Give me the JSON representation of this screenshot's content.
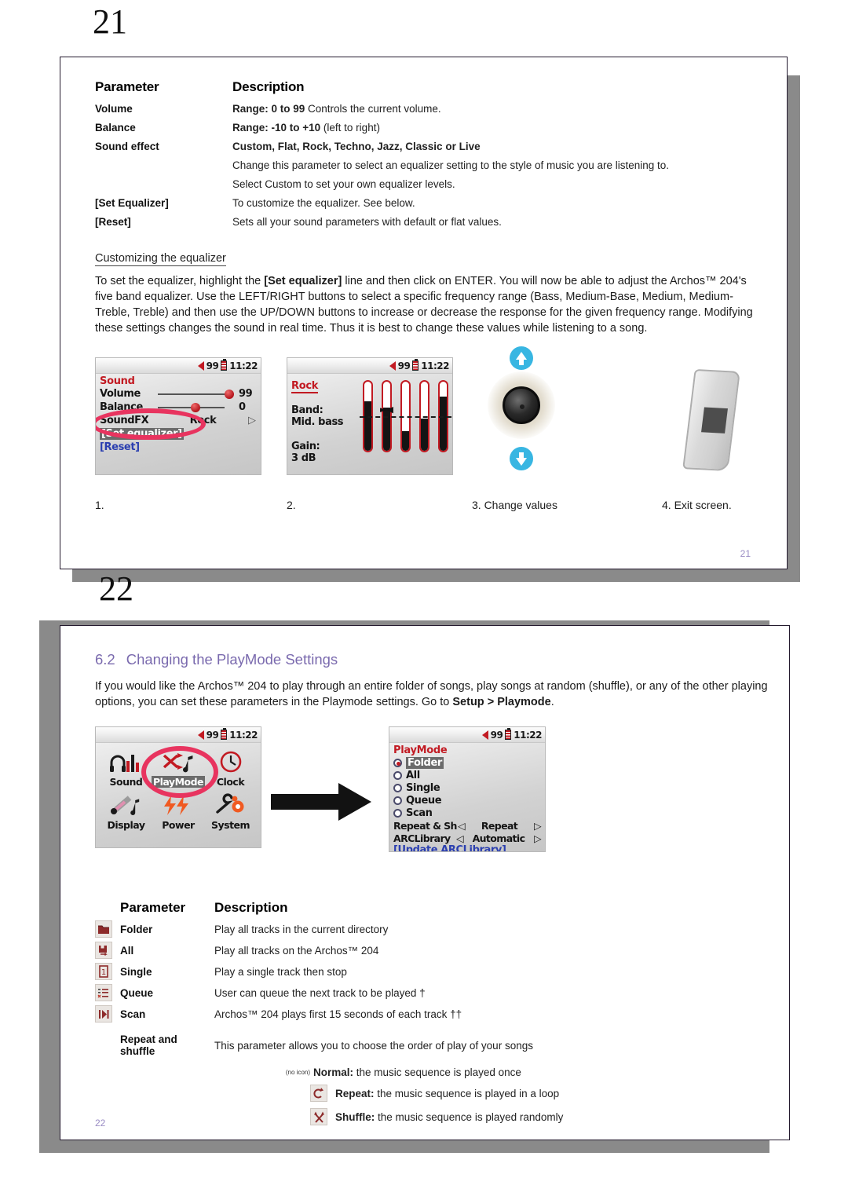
{
  "pages": {
    "p21": {
      "marker": "21",
      "folio": "21"
    },
    "p22": {
      "marker": "22",
      "folio": "22"
    }
  },
  "page21": {
    "table": {
      "header": {
        "parameter": "Parameter",
        "description": "Description"
      },
      "rows": [
        {
          "parameter": "Volume",
          "desc_bold": "Range: 0 to 99",
          "desc_rest": " Controls the current volume."
        },
        {
          "parameter": "Balance",
          "desc_bold": "Range: -10 to +10",
          "desc_rest": " (left to right)"
        },
        {
          "parameter": "Sound effect",
          "desc_bold": "Custom, Flat, Rock, Techno, Jazz, Classic or Live",
          "desc_rest": ""
        },
        {
          "parameter": "",
          "desc_bold": "",
          "desc_rest": "Change this parameter to select an equalizer setting to the style of music you are listening to."
        },
        {
          "parameter": "",
          "desc_bold": "",
          "desc_rest": "Select Custom to set your own equalizer levels."
        },
        {
          "parameter": "[Set Equalizer]",
          "desc_bold": "",
          "desc_rest": "To customize the equalizer. See below."
        },
        {
          "parameter": "[Reset]",
          "desc_bold": "",
          "desc_rest": "Sets all your sound parameters with default or flat values."
        }
      ]
    },
    "subheading": "Customizing the equalizer",
    "paragraph_1": "To set the equalizer, highlight the ",
    "paragraph_bold": "[Set equalizer]",
    "paragraph_2": " line and then click on ENTER. You will now be able to adjust the Archos™ 204's five band equalizer. Use the LEFT/RIGHT buttons to select a specific frequency range (Bass, Medium-Base, Medium, Medium-Treble, Treble) and then use the UP/DOWN buttons to increase or decrease the response for the given frequency range. Modifying these settings changes the sound in real time. Thus it is best to change these values while listening to a song.",
    "screen_sound": {
      "status": {
        "volume": "99",
        "time": "11:22"
      },
      "title": "Sound",
      "rows": [
        {
          "label": "Volume",
          "value": "99",
          "knob_pct": 88
        },
        {
          "label": "Balance",
          "value": "0",
          "knob_pct": 45
        }
      ],
      "sound_fx_label": "SoundFX",
      "sound_fx_value": "Rock",
      "sound_fx_arrow": "▷",
      "set_equalizer": "[Set equalizer]",
      "reset": "[Reset]"
    },
    "screen_eq": {
      "status": {
        "volume": "99",
        "time": "11:22"
      },
      "title": "Rock",
      "band_label": "Band:",
      "band_value": "Mid. bass",
      "gain_label": "Gain:",
      "gain_value": "3 dB",
      "bars": [
        72,
        62,
        28,
        47,
        78
      ],
      "selected_bar_index": 1
    },
    "steps": [
      {
        "label": "1."
      },
      {
        "label": "2."
      },
      {
        "label": "3. Change values"
      },
      {
        "label": "4. Exit screen."
      }
    ]
  },
  "page22": {
    "section": {
      "number": "6.2",
      "title": "Changing the PlayMode Settings"
    },
    "intro": "If you would like the Archos™ 204 to play through an entire folder of songs, play songs at random (shuffle), or any of the other playing options, you can set these parameters in the Playmode settings. Go to ",
    "intro_bold": "Setup > Playmode",
    "intro_end": ".",
    "screen_setup": {
      "status": {
        "volume": "99",
        "time": "11:22"
      },
      "items": [
        {
          "label": "Sound",
          "icon": "equalizer-headphones-icon"
        },
        {
          "label": "PlayMode",
          "icon": "shuffle-note-icon",
          "highlighted": true
        },
        {
          "label": "Clock",
          "icon": "clock-icon"
        },
        {
          "label": "Display",
          "icon": "display-icon"
        },
        {
          "label": "Power",
          "icon": "power-bolt-icon"
        },
        {
          "label": "System",
          "icon": "wrench-gear-icon"
        }
      ]
    },
    "screen_playmode": {
      "status": {
        "volume": "99",
        "time": "11:22"
      },
      "title": "PlayMode",
      "options": [
        {
          "label": "Folder",
          "selected": true,
          "highlighted": true
        },
        {
          "label": "All",
          "selected": false,
          "highlighted": false
        },
        {
          "label": "Single",
          "selected": false,
          "highlighted": false
        },
        {
          "label": "Queue",
          "selected": false,
          "highlighted": false
        },
        {
          "label": "Scan",
          "selected": false,
          "highlighted": false
        }
      ],
      "settings": [
        {
          "label": "Repeat & Sh",
          "left_arrow": "◁",
          "value": "Repeat",
          "right_arrow": "▷"
        },
        {
          "label": "ARCLibrary",
          "left_arrow": "◁",
          "value": "Automatic",
          "right_arrow": "▷"
        }
      ],
      "update_link": "[Update ARCLibrary]"
    },
    "table": {
      "header": {
        "parameter": "Parameter",
        "description": "Description"
      },
      "rows": [
        {
          "icon": "folder-icon",
          "glyph": "▰",
          "name": "Folder",
          "desc": "Play all tracks in the current directory"
        },
        {
          "icon": "save-all-icon",
          "glyph": "▣",
          "name": "All",
          "desc": "Play all tracks on the Archos™ 204"
        },
        {
          "icon": "single-track-icon",
          "glyph": "1",
          "name": "Single",
          "desc": "Play a single track then stop"
        },
        {
          "icon": "queue-list-icon",
          "glyph": "≡",
          "name": "Queue",
          "desc": "User can queue the next track to be played †"
        },
        {
          "icon": "scan-icon",
          "glyph": "▶",
          "name": "Scan",
          "desc": "Archos™ 204 plays first 15 seconds of each track ††"
        }
      ],
      "repeat_shuffle": {
        "name": "Repeat and shuffle",
        "desc": "This parameter allows you to choose the order of play of your songs",
        "modes": [
          {
            "icon_caption": "(no icon)",
            "glyph": "",
            "bold": "Normal:",
            "rest": " the music sequence is played once"
          },
          {
            "icon_caption": "",
            "glyph": "↺",
            "bold": "Repeat:",
            "rest": " the music sequence is played in a loop"
          },
          {
            "icon_caption": "",
            "glyph": "⤨",
            "bold": "Shuffle:",
            "rest": " the music sequence is played randomly"
          }
        ]
      }
    }
  }
}
